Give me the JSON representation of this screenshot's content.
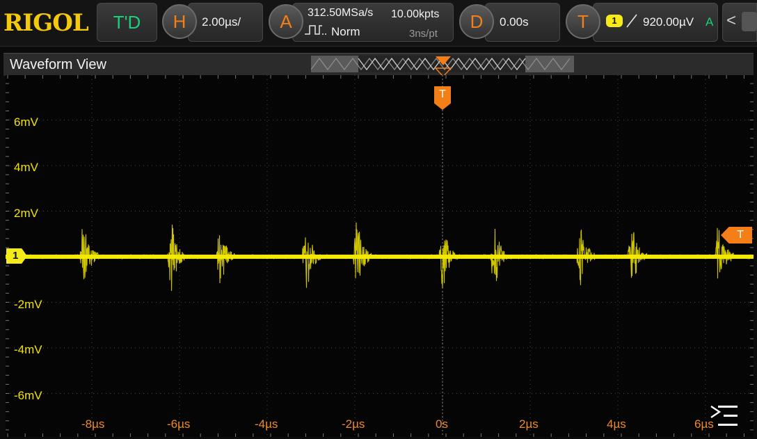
{
  "brand": "RIGOL",
  "topbar": {
    "mode_label": "T'D",
    "horizontal": {
      "key": "H",
      "value": "2.00µs/"
    },
    "acquire": {
      "key": "A",
      "rate": "312.50MSa/s",
      "depth": "10.00kpts",
      "mode": "Norm",
      "resolution": "3ns/pt"
    },
    "delay": {
      "key": "D",
      "value": "0.00s"
    },
    "trigger": {
      "key": "T",
      "channel": "1",
      "level": "920.00µV",
      "status": "A"
    },
    "nav_arrow": "<"
  },
  "view": {
    "title": "Waveform View"
  },
  "y_axis": [
    "6mV",
    "4mV",
    "2mV",
    "-2mV",
    "-4mV",
    "-6mV"
  ],
  "x_axis": [
    "-8µs",
    "-6µs",
    "-4µs",
    "-2µs",
    "0s",
    "2µs",
    "4µs",
    "6µs"
  ],
  "markers": {
    "channel": "1",
    "trigger": "T",
    "trigger_top": "T"
  },
  "colors": {
    "waveform": "#f2e800",
    "trigger": "#f47f17",
    "axis_labels": "#f2e400",
    "mode_label": "#19d07a"
  },
  "icons": {
    "menu": "menu-collapse-icon",
    "wave": "pulse-wave-icon",
    "edge": "rising-edge-icon"
  }
}
